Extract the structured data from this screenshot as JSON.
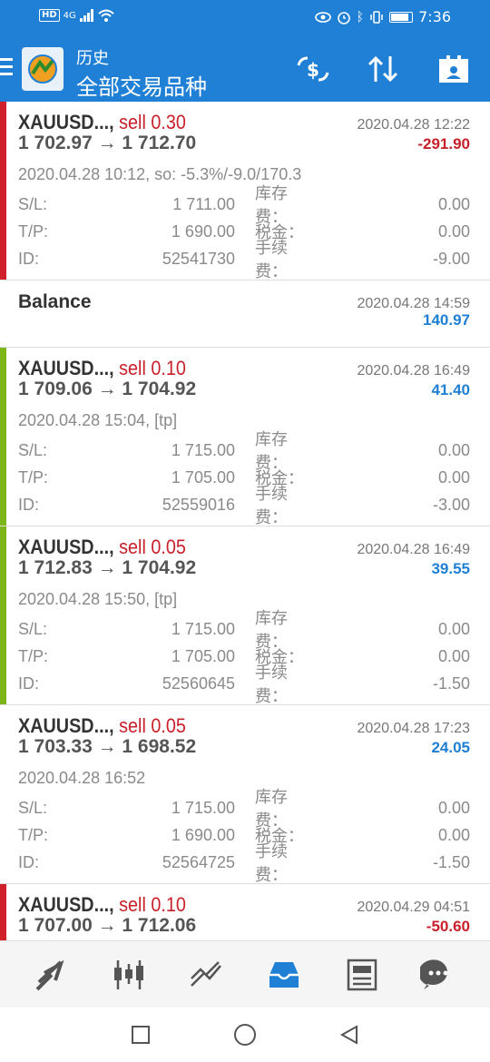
{
  "status": {
    "time": "7:36",
    "network": "4G"
  },
  "header": {
    "subtitle": "历史",
    "title": "全部交易品种"
  },
  "items": [
    {
      "symbol": "XAUUSD...,",
      "side": "sell 0.30",
      "time": "2020.04.28 12:22",
      "prices": "1 702.97 → 1 712.70",
      "profit": "-291.90",
      "detail": "2020.04.28 10:12, so: -5.3%/-9.0/170.3",
      "sl_label": "S/L:",
      "sl": "1 711.00",
      "swap_label": "库存费：",
      "swap": "0.00",
      "tp_label": "T/P:",
      "tp": "1 690.00",
      "tax_label": "税金：",
      "tax": "0.00",
      "id_label": "ID:",
      "id": "52541730",
      "fee_label": "手续费：",
      "fee": "-9.00",
      "bar": "#d0202a"
    },
    {
      "label": "Balance",
      "time": "2020.04.28 14:59",
      "profit": "140.97"
    },
    {
      "symbol": "XAUUSD...,",
      "side": "sell 0.10",
      "time": "2020.04.28 16:49",
      "prices": "1 709.06 → 1 704.92",
      "profit": "41.40",
      "detail": "2020.04.28 15:04, [tp]",
      "sl_label": "S/L:",
      "sl": "1 715.00",
      "swap_label": "库存费：",
      "swap": "0.00",
      "tp_label": "T/P:",
      "tp": "1 705.00",
      "tax_label": "税金：",
      "tax": "0.00",
      "id_label": "ID:",
      "id": "52559016",
      "fee_label": "手续费：",
      "fee": "-3.00",
      "bar": "#7cb518"
    },
    {
      "symbol": "XAUUSD...,",
      "side": "sell 0.05",
      "time": "2020.04.28 16:49",
      "prices": "1 712.83 → 1 704.92",
      "profit": "39.55",
      "detail": "2020.04.28 15:50, [tp]",
      "sl_label": "S/L:",
      "sl": "1 715.00",
      "swap_label": "库存费：",
      "swap": "0.00",
      "tp_label": "T/P:",
      "tp": "1 705.00",
      "tax_label": "税金：",
      "tax": "0.00",
      "id_label": "ID:",
      "id": "52560645",
      "fee_label": "手续费：",
      "fee": "-1.50",
      "bar": "#7cb518"
    },
    {
      "symbol": "XAUUSD...,",
      "side": "sell 0.05",
      "time": "2020.04.28 17:23",
      "prices": "1 703.33 → 1 698.52",
      "profit": "24.05",
      "detail": "2020.04.28 16:52",
      "sl_label": "S/L:",
      "sl": "1 715.00",
      "swap_label": "库存费：",
      "swap": "0.00",
      "tp_label": "T/P:",
      "tp": "1 690.00",
      "tax_label": "税金：",
      "tax": "0.00",
      "id_label": "ID:",
      "id": "52564725",
      "fee_label": "手续费：",
      "fee": "-1.50",
      "bar": ""
    },
    {
      "symbol": "XAUUSD...,",
      "side": "sell 0.10",
      "time": "2020.04.29 04:51",
      "prices": "1 707.00 → 1 712.06",
      "profit": "-50.60",
      "bar": "#d0202a"
    }
  ],
  "icons": {
    "exchange": "currency-exchange-icon",
    "sort": "sort-icon",
    "report": "report-icon"
  },
  "colors": {
    "primary": "#1f80d6",
    "loss": "#c8202a",
    "gain": "#1f7fd4",
    "profit_bar": "#7cb518"
  }
}
